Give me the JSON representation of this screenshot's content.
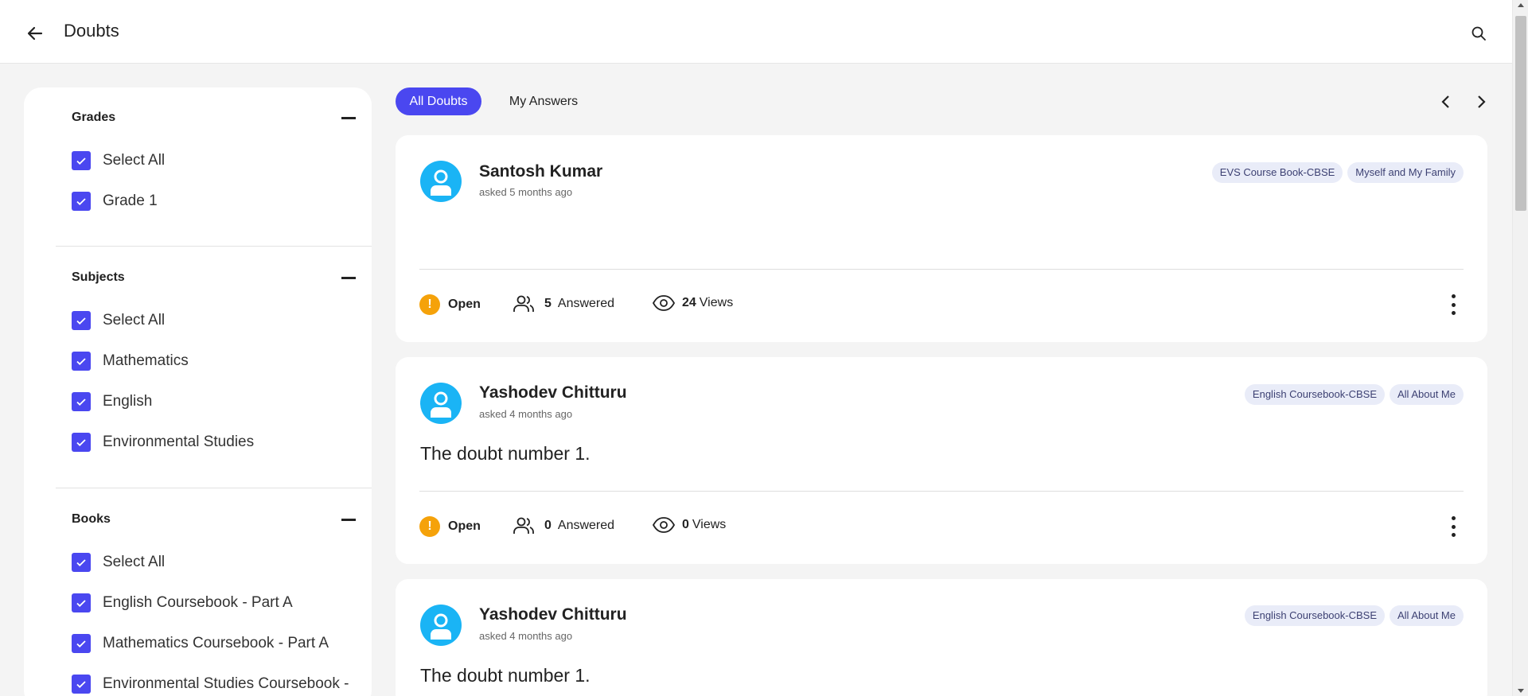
{
  "header": {
    "title": "Doubts"
  },
  "tabs": [
    {
      "label": "All Doubts",
      "active": true
    },
    {
      "label": "My Answers",
      "active": false
    }
  ],
  "filters": {
    "grades": {
      "title": "Grades",
      "options": [
        "Select All",
        "Grade 1"
      ]
    },
    "subjects": {
      "title": "Subjects",
      "options": [
        "Select All",
        "Mathematics",
        "English",
        "Environmental Studies"
      ]
    },
    "books": {
      "title": "Books",
      "options": [
        "Select All",
        "English Coursebook - Part A",
        "Mathematics Coursebook - Part A",
        "Environmental Studies Coursebook -"
      ]
    }
  },
  "colors": {
    "accent": "#4a47f0",
    "avatar": "#1ab4f5",
    "status_open": "#f5a20a",
    "tag_bg": "#e9ecf8"
  },
  "doubts": [
    {
      "author": "Santosh Kumar",
      "asked": "asked 5 months ago",
      "tags": [
        "EVS Course Book-CBSE",
        "Myself and My Family"
      ],
      "text": "",
      "status": "Open",
      "answered_count": "5",
      "answered_label": "Answered",
      "views_count": "24",
      "views_label": "Views"
    },
    {
      "author": "Yashodev Chitturu",
      "asked": "asked 4 months ago",
      "tags": [
        "English Coursebook-CBSE",
        "All About Me"
      ],
      "text": "The doubt number 1.",
      "status": "Open",
      "answered_count": "0",
      "answered_label": "Answered",
      "views_count": "0",
      "views_label": "Views"
    },
    {
      "author": "Yashodev Chitturu",
      "asked": "asked 4 months ago",
      "tags": [
        "English Coursebook-CBSE",
        "All About Me"
      ],
      "text": "The doubt number 1.",
      "status": "",
      "answered_count": "",
      "answered_label": "",
      "views_count": "",
      "views_label": ""
    }
  ]
}
